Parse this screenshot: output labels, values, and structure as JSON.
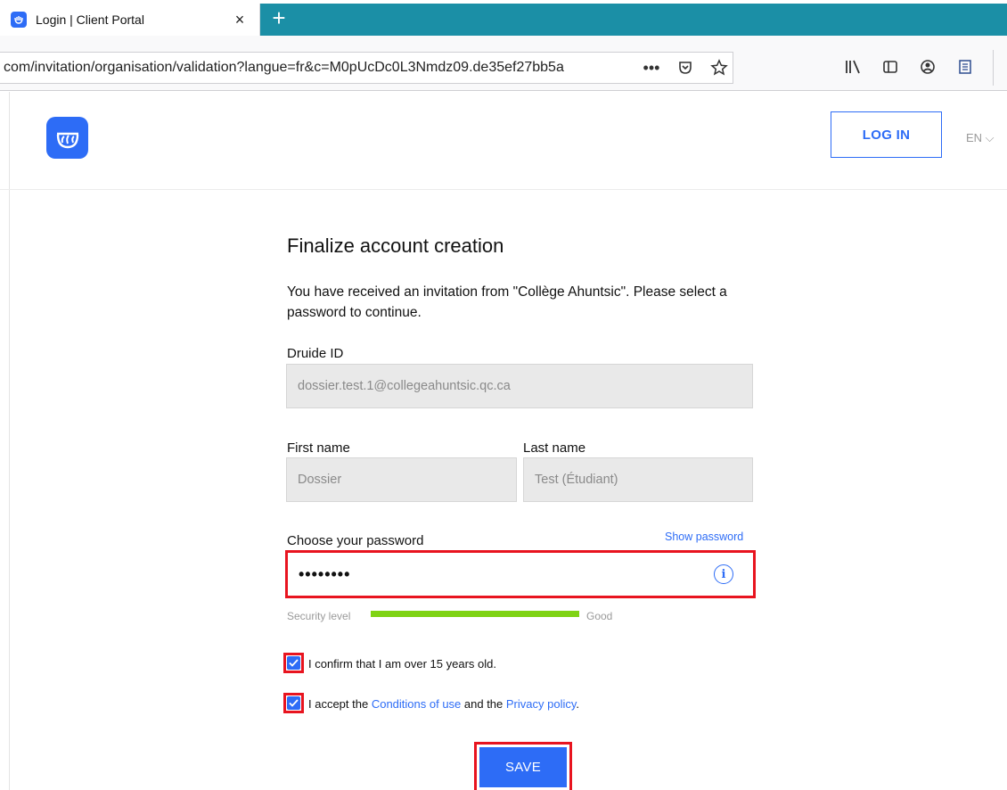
{
  "browser": {
    "tab_title": "Login | Client Portal",
    "tab_close": "×",
    "new_tab": "+",
    "url": "com/invitation/organisation/validation?langue=fr&c=M0pUcDc0L3Nmdz09.de35ef27bb5a",
    "url_more": "•••"
  },
  "header": {
    "login_label": "LOG IN",
    "lang_label": "EN ⌵"
  },
  "form": {
    "title": "Finalize account creation",
    "description": "You have received an invitation from \"Collège Ahuntsic\". Please select a password to continue.",
    "druide_id_label": "Druide ID",
    "druide_id_value": "dossier.test.1@collegeahuntsic.qc.ca",
    "first_name_label": "First name",
    "first_name_value": "Dossier",
    "last_name_label": "Last name",
    "last_name_value": "Test (Étudiant)",
    "password_label": "Choose your password",
    "show_password": "Show password",
    "password_value": "••••••••",
    "info_glyph": "i",
    "security_label": "Security level",
    "security_value": "Good",
    "security_level": 1.0,
    "age_confirm": "I confirm that I am over 15 years old.",
    "accept_prefix": "I accept the ",
    "conditions_link": "Conditions of use",
    "accept_middle": " and the ",
    "privacy_link": "Privacy policy",
    "accept_suffix": ".",
    "age_checked": true,
    "terms_checked": true,
    "save_label": "SAVE"
  },
  "colors": {
    "accent": "#2d6cf6",
    "highlight": "#e8141f",
    "security_good": "#7fd314",
    "tabbar": "#1b8fa6"
  }
}
